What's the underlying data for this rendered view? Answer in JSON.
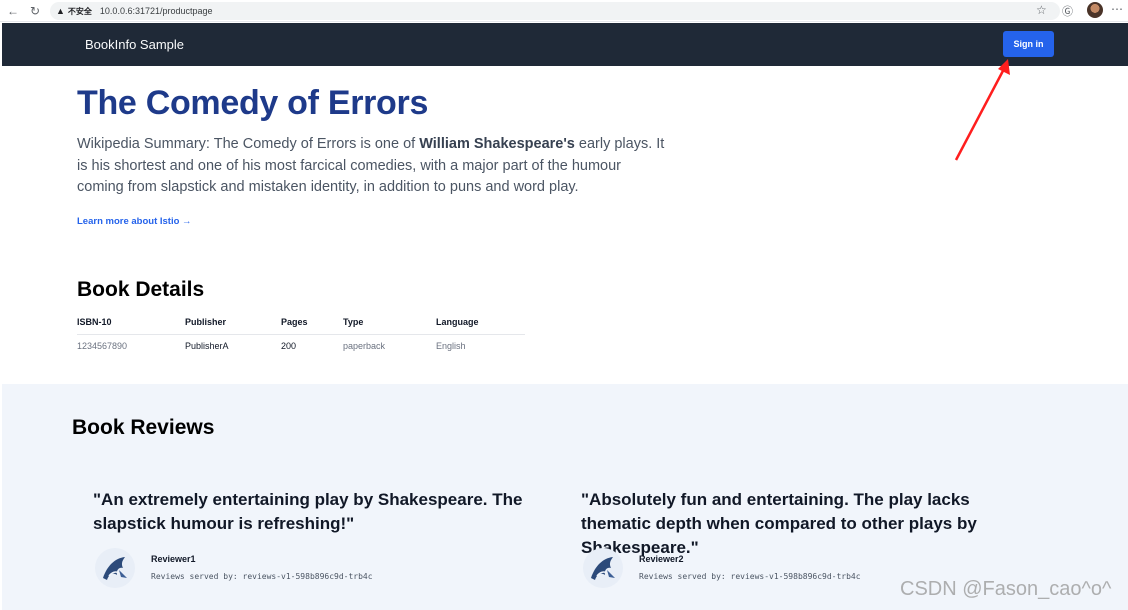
{
  "browser": {
    "back_icon": "back-arrow-icon",
    "reload_icon": "reload-icon",
    "security_label": "不安全",
    "url": "10.0.0.6:31721/productpage"
  },
  "header": {
    "brand": "BookInfo Sample",
    "signin_label": "Sign in"
  },
  "product": {
    "title": "The Comedy of Errors",
    "summary_prefix": "Wikipedia Summary: The Comedy of Errors is one of ",
    "summary_bold": "William Shakespeare's",
    "summary_suffix": " early plays. It is his shortest and one of his most farcical comedies, with a major part of the humour coming from slapstick and mistaken identity, in addition to puns and word play.",
    "learn_more": "Learn more about Istio →"
  },
  "details": {
    "title": "Book Details",
    "headers": [
      "ISBN-10",
      "Publisher",
      "Pages",
      "Type",
      "Language"
    ],
    "row": [
      "1234567890",
      "PublisherA",
      "200",
      "paperback",
      "English"
    ]
  },
  "reviews": {
    "title": "Book Reviews",
    "items": [
      {
        "text": "\"An extremely entertaining play by Shakespeare. The slapstick humour is refreshing!\"",
        "reviewer": "Reviewer1",
        "served_by": "Reviews served by: reviews-v1-598b896c9d-trb4c"
      },
      {
        "text": "\"Absolutely fun and entertaining. The play lacks thematic depth when compared to other plays by Shakespeare.\"",
        "reviewer": "Reviewer2",
        "served_by": "Reviews served by: reviews-v1-598b896c9d-trb4c"
      }
    ]
  },
  "watermark": "CSDN @Fason_cao^o^",
  "colors": {
    "header_bg": "#1f2937",
    "accent": "#2563eb",
    "title": "#1e3a8a",
    "reviews_bg": "#f1f5fb",
    "annotation": "#ff1e1e"
  }
}
